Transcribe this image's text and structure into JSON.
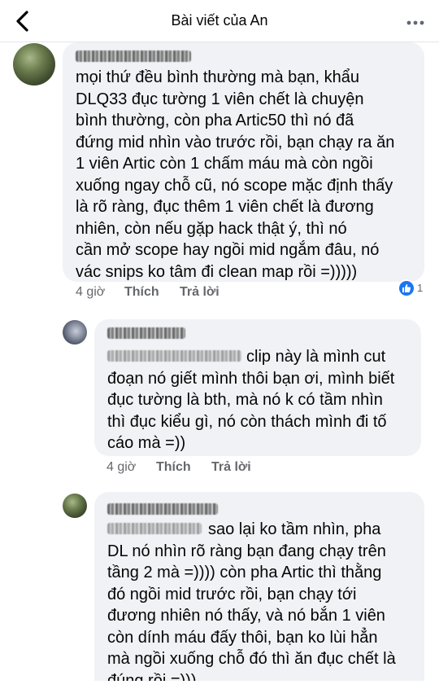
{
  "header": {
    "title": "Bài viết của An"
  },
  "comments": [
    {
      "lines": "mọi thứ đều bình thường mà bạn, khẩu\nDLQ33 đục tường 1 viên chết là chuyện\nbình thường, còn pha Artic50 thì nó đã\nđứng mid nhìn vào trước rồi, bạn chạy ra ăn\n1 viên Artic còn 1 chấm máu mà còn ngồi\nxuống ngay chỗ cũ, nó scope mặc định thấy\nlà rõ ràng, đục thêm 1 viên chết là đương\nnhiên, còn nếu gặp hack thật ý, thì nó\ncần mở scope hay ngồi mid ngắm đâu, nó\nvác snips ko tâm đi clean map rồi =)))))",
      "time": "4 giờ",
      "like": "Thích",
      "reply": "Trả lời",
      "reaction_count": "1"
    },
    {
      "lines": "clip này là mình cut\nđoạn nó giết mình thôi bạn ơi, mình biết\nđục tường là bth, mà nó k có tầm nhìn\nthì đục kiểu gì, nó còn thách mình đi tố\ncáo mà =))",
      "time": "4 giờ",
      "like": "Thích",
      "reply": "Trả lời"
    },
    {
      "lines": "sao lại ko tầm nhìn, pha\nDL nó nhìn rõ ràng bạn đang chạy trên\ntầng 2 mà =)))) còn pha Artic thì thằng\nđó ngồi mid trước rồi, bạn chạy tới\nđương nhiên nó thấy, và nó bắn 1 viên\ncòn dính máu đấy thôi, bạn ko lùi hẳn\nmà ngồi xuống chỗ đó thì ăn đục chết là\nđúng rồi =)))"
    }
  ],
  "colors": {
    "bubble": "#f0f2f5",
    "meta": "#65676b",
    "like_blue": "#1877f2"
  },
  "icons": {
    "back": "chevron-left-icon",
    "more": "more-dots-icon",
    "reaction": "like-thumb-icon"
  }
}
